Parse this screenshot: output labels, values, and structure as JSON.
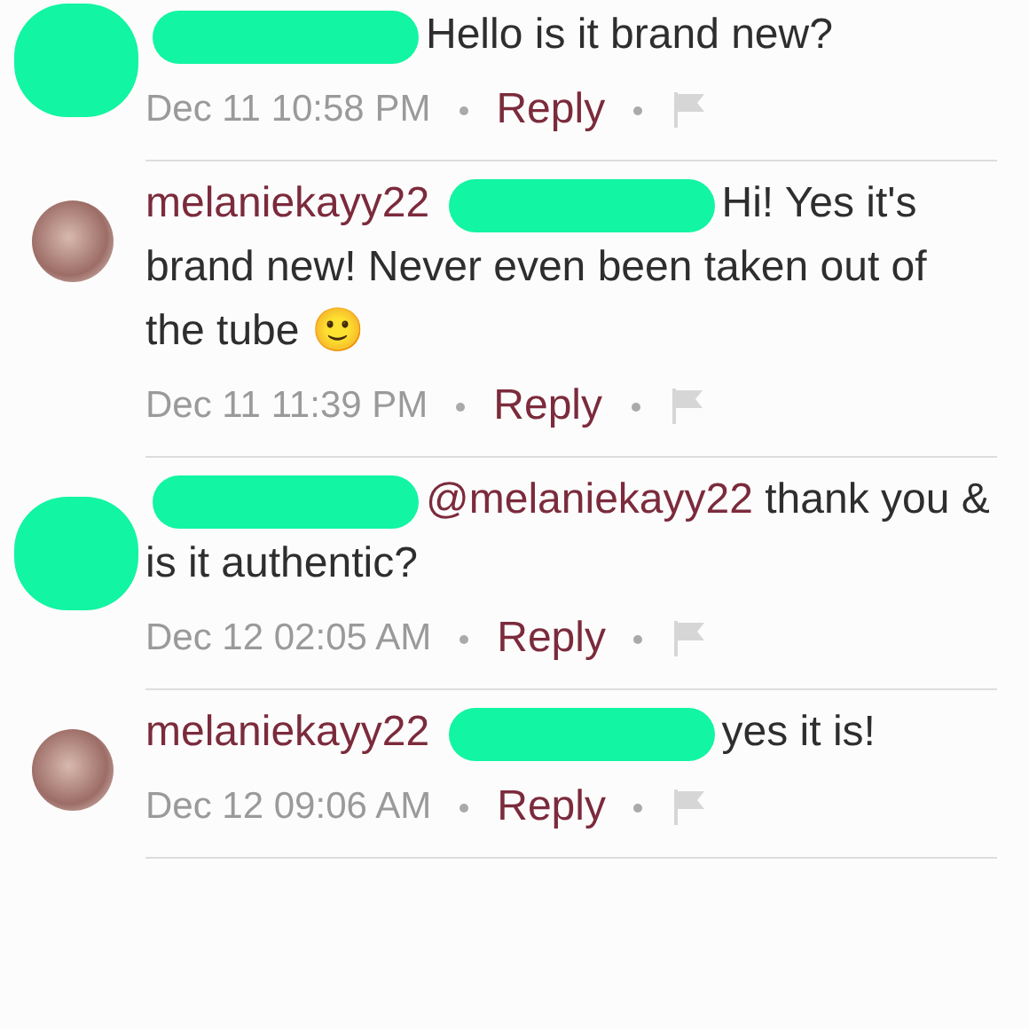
{
  "comments": [
    {
      "avatar_redacted": true,
      "segments": [
        {
          "kind": "redacted"
        },
        {
          "kind": "text",
          "text": "Hello is it brand new?"
        }
      ],
      "time": "Dec 11 10:58 PM",
      "reply": "Reply"
    },
    {
      "avatar_redacted": false,
      "segments": [
        {
          "kind": "author",
          "text": "melaniekayy22"
        },
        {
          "kind": "redacted"
        },
        {
          "kind": "text",
          "text": "Hi! Yes it's brand new! Never even been taken out of the tube 🙂"
        }
      ],
      "time": "Dec 11 11:39 PM",
      "reply": "Reply"
    },
    {
      "avatar_redacted": true,
      "segments": [
        {
          "kind": "redacted"
        },
        {
          "kind": "mention",
          "text": "@melaniekayy22"
        },
        {
          "kind": "text",
          "text": "thank you & is it authentic?"
        }
      ],
      "time": "Dec 12 02:05 AM",
      "reply": "Reply"
    },
    {
      "avatar_redacted": false,
      "segments": [
        {
          "kind": "author",
          "text": "melaniekayy22"
        },
        {
          "kind": "redacted"
        },
        {
          "kind": "text",
          "text": "yes it is!"
        }
      ],
      "time": "Dec 12 09:06 AM",
      "reply": "Reply"
    }
  ]
}
